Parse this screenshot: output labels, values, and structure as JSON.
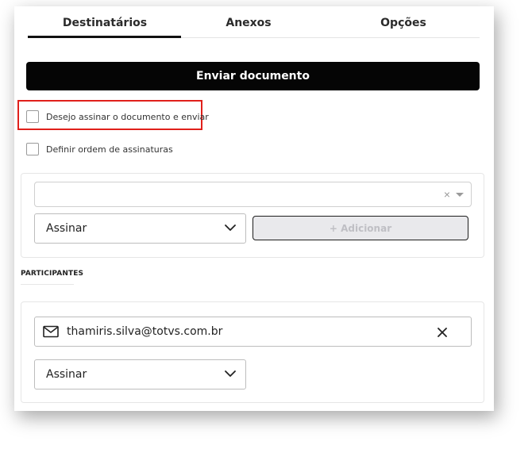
{
  "tabs": [
    {
      "label": "Destinatários",
      "active": true
    },
    {
      "label": "Anexos",
      "active": false
    },
    {
      "label": "Opções",
      "active": false
    }
  ],
  "send_button": {
    "label": "Enviar documento"
  },
  "options": {
    "sign_and_send": {
      "label": "Desejo assinar o documento e enviar",
      "checked": false
    },
    "signature_order": {
      "label": "Definir ordem de assinaturas",
      "checked": false
    }
  },
  "add_recipient": {
    "search_value": "",
    "clear_glyph": "×",
    "action_select": {
      "value": "Assinar"
    },
    "add_button": {
      "label": "+ Adicionar",
      "disabled": true
    }
  },
  "participants": {
    "title": "PARTICIPANTES",
    "items": [
      {
        "email": "thamiris.silva@totvs.com.br",
        "action": "Assinar",
        "icon": "mail-icon"
      }
    ]
  },
  "colors": {
    "primary_button": "#050505",
    "highlight_box": "#e0201b",
    "disabled_button_bg": "#e9e9ec"
  }
}
